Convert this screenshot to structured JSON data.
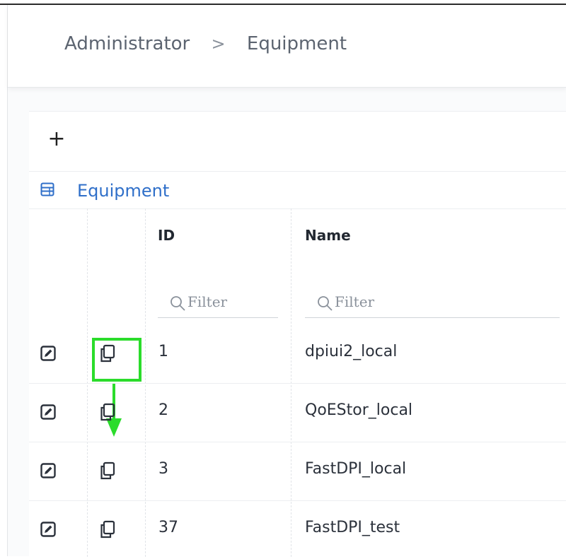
{
  "breadcrumb": {
    "items": [
      "Administrator",
      "Equipment"
    ],
    "separator": ">"
  },
  "toolbar": {
    "add_label": "+"
  },
  "section": {
    "title": "Equipment",
    "icon": "server-list-icon"
  },
  "table": {
    "columns": {
      "id": "ID",
      "name": "Name"
    },
    "filters": {
      "id_placeholder": "Filter",
      "name_placeholder": "Filter"
    },
    "row_icons": {
      "edit": "edit-icon",
      "copy": "copy-icon"
    },
    "rows": [
      {
        "id": "1",
        "name": "dpiui2_local"
      },
      {
        "id": "2",
        "name": "QoEStor_local"
      },
      {
        "id": "3",
        "name": "FastDPI_local"
      },
      {
        "id": "37",
        "name": "FastDPI_test"
      }
    ]
  },
  "annotation": {
    "highlight_color": "#2bdc2b",
    "target": "copy-button row 1"
  },
  "colors": {
    "accent": "#2f6fc9",
    "text": "#2b313b"
  }
}
